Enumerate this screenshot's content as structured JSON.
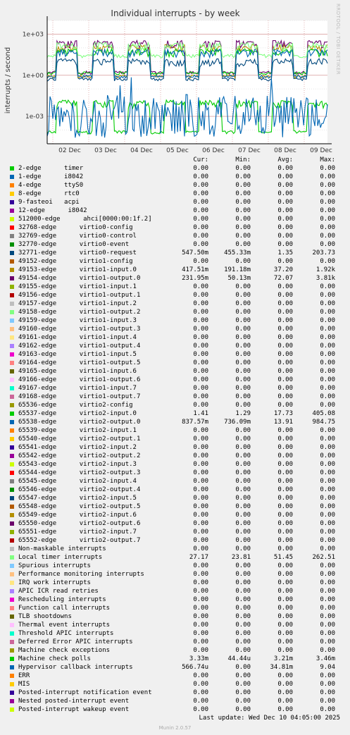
{
  "chart_data": {
    "type": "line",
    "title": "Individual interrupts - by week",
    "ylabel": "interrupts / second",
    "yscale": "log",
    "ylim": [
      1e-05,
      10000
    ],
    "yticks": [
      "1e+03",
      "1e+00",
      "1e-03"
    ],
    "xticks": [
      "02 Dec",
      "03 Dec",
      "04 Dec",
      "05 Dec",
      "06 Dec",
      "07 Dec",
      "08 Dec",
      "09 Dec"
    ],
    "grid": true,
    "columns": [
      "Cur:",
      "Min:",
      "Avg:",
      "Max:"
    ],
    "series": [
      {
        "name": "2-edge      timer",
        "color": "#00cc00",
        "cur": "0.00",
        "min": "0.00",
        "avg": "0.00",
        "max": "0.00"
      },
      {
        "name": "1-edge      i8042",
        "color": "#0066b3",
        "cur": "0.00",
        "min": "0.00",
        "avg": "0.00",
        "max": "0.00"
      },
      {
        "name": "4-edge      ttyS0",
        "color": "#ff8000",
        "cur": "0.00",
        "min": "0.00",
        "avg": "0.00",
        "max": "0.00"
      },
      {
        "name": "8-edge      rtc0",
        "color": "#ffcc00",
        "cur": "0.00",
        "min": "0.00",
        "avg": "0.00",
        "max": "0.00"
      },
      {
        "name": "9-fasteoi   acpi",
        "color": "#330099",
        "cur": "0.00",
        "min": "0.00",
        "avg": "0.00",
        "max": "0.00"
      },
      {
        "name": "12-edge      i8042",
        "color": "#990099",
        "cur": "0.00",
        "min": "0.00",
        "avg": "0.00",
        "max": "0.00"
      },
      {
        "name": "512000-edge      ahci[0000:00:1f.2]",
        "color": "#ccff00",
        "cur": "0.00",
        "min": "0.00",
        "avg": "0.00",
        "max": "0.00"
      },
      {
        "name": "32768-edge      virtio0-config",
        "color": "#ff0000",
        "cur": "0.00",
        "min": "0.00",
        "avg": "0.00",
        "max": "0.00"
      },
      {
        "name": "32769-edge      virtio0-control",
        "color": "#808080",
        "cur": "0.00",
        "min": "0.00",
        "avg": "0.00",
        "max": "0.00"
      },
      {
        "name": "32770-edge      virtio0-event",
        "color": "#008f00",
        "cur": "0.00",
        "min": "0.00",
        "avg": "0.00",
        "max": "0.00"
      },
      {
        "name": "32771-edge      virtio0-request",
        "color": "#00487d",
        "cur": "547.50m",
        "min": "455.33m",
        "avg": "1.35",
        "max": "203.73"
      },
      {
        "name": "49152-edge      virtio1-config",
        "color": "#b35a00",
        "cur": "0.00",
        "min": "0.00",
        "avg": "0.00",
        "max": "0.00"
      },
      {
        "name": "49153-edge      virtio1-input.0",
        "color": "#b38f00",
        "cur": "417.51m",
        "min": "191.18m",
        "avg": "37.20",
        "max": "1.92k"
      },
      {
        "name": "49154-edge      virtio1-output.0",
        "color": "#6b006b",
        "cur": "231.95m",
        "min": "50.13m",
        "avg": "72.07",
        "max": "3.81k"
      },
      {
        "name": "49155-edge      virtio1-input.1",
        "color": "#8fb300",
        "cur": "0.00",
        "min": "0.00",
        "avg": "0.00",
        "max": "0.00"
      },
      {
        "name": "49156-edge      virtio1-output.1",
        "color": "#b30000",
        "cur": "0.00",
        "min": "0.00",
        "avg": "0.00",
        "max": "0.00"
      },
      {
        "name": "49157-edge      virtio1-input.2",
        "color": "#bebebe",
        "cur": "0.00",
        "min": "0.00",
        "avg": "0.00",
        "max": "0.00"
      },
      {
        "name": "49158-edge      virtio1-output.2",
        "color": "#80ff80",
        "cur": "0.00",
        "min": "0.00",
        "avg": "0.00",
        "max": "0.00"
      },
      {
        "name": "49159-edge      virtio1-input.3",
        "color": "#80c9ff",
        "cur": "0.00",
        "min": "0.00",
        "avg": "0.00",
        "max": "0.00"
      },
      {
        "name": "49160-edge      virtio1-output.3",
        "color": "#ffc080",
        "cur": "0.00",
        "min": "0.00",
        "avg": "0.00",
        "max": "0.00"
      },
      {
        "name": "49161-edge      virtio1-input.4",
        "color": "#ffe680",
        "cur": "0.00",
        "min": "0.00",
        "avg": "0.00",
        "max": "0.00"
      },
      {
        "name": "49162-edge      virtio1-output.4",
        "color": "#aa80ff",
        "cur": "0.00",
        "min": "0.00",
        "avg": "0.00",
        "max": "0.00"
      },
      {
        "name": "49163-edge      virtio1-input.5",
        "color": "#ee00cc",
        "cur": "0.00",
        "min": "0.00",
        "avg": "0.00",
        "max": "0.00"
      },
      {
        "name": "49164-edge      virtio1-output.5",
        "color": "#ff8080",
        "cur": "0.00",
        "min": "0.00",
        "avg": "0.00",
        "max": "0.00"
      },
      {
        "name": "49165-edge      virtio1-input.6",
        "color": "#666600",
        "cur": "0.00",
        "min": "0.00",
        "avg": "0.00",
        "max": "0.00"
      },
      {
        "name": "49166-edge      virtio1-output.6",
        "color": "#ffbfff",
        "cur": "0.00",
        "min": "0.00",
        "avg": "0.00",
        "max": "0.00"
      },
      {
        "name": "49167-edge      virtio1-input.7",
        "color": "#00ffcc",
        "cur": "0.00",
        "min": "0.00",
        "avg": "0.00",
        "max": "0.00"
      },
      {
        "name": "49168-edge      virtio1-output.7",
        "color": "#cc6699",
        "cur": "0.00",
        "min": "0.00",
        "avg": "0.00",
        "max": "0.00"
      },
      {
        "name": "65536-edge      virtio2-config",
        "color": "#999900",
        "cur": "0.00",
        "min": "0.00",
        "avg": "0.00",
        "max": "0.00"
      },
      {
        "name": "65537-edge      virtio2-input.0",
        "color": "#00cc00",
        "cur": "1.41",
        "min": "1.29",
        "avg": "17.73",
        "max": "405.08"
      },
      {
        "name": "65538-edge      virtio2-output.0",
        "color": "#0066b3",
        "cur": "837.57m",
        "min": "736.09m",
        "avg": "13.91",
        "max": "984.75"
      },
      {
        "name": "65539-edge      virtio2-input.1",
        "color": "#ff8000",
        "cur": "0.00",
        "min": "0.00",
        "avg": "0.00",
        "max": "0.00"
      },
      {
        "name": "65540-edge      virtio2-output.1",
        "color": "#ffcc00",
        "cur": "0.00",
        "min": "0.00",
        "avg": "0.00",
        "max": "0.00"
      },
      {
        "name": "65541-edge      virtio2-input.2",
        "color": "#330099",
        "cur": "0.00",
        "min": "0.00",
        "avg": "0.00",
        "max": "0.00"
      },
      {
        "name": "65542-edge      virtio2-output.2",
        "color": "#990099",
        "cur": "0.00",
        "min": "0.00",
        "avg": "0.00",
        "max": "0.00"
      },
      {
        "name": "65543-edge      virtio2-input.3",
        "color": "#ccff00",
        "cur": "0.00",
        "min": "0.00",
        "avg": "0.00",
        "max": "0.00"
      },
      {
        "name": "65544-edge      virtio2-output.3",
        "color": "#ff0000",
        "cur": "0.00",
        "min": "0.00",
        "avg": "0.00",
        "max": "0.00"
      },
      {
        "name": "65545-edge      virtio2-input.4",
        "color": "#808080",
        "cur": "0.00",
        "min": "0.00",
        "avg": "0.00",
        "max": "0.00"
      },
      {
        "name": "65546-edge      virtio2-output.4",
        "color": "#008f00",
        "cur": "0.00",
        "min": "0.00",
        "avg": "0.00",
        "max": "0.00"
      },
      {
        "name": "65547-edge      virtio2-input.5",
        "color": "#00487d",
        "cur": "0.00",
        "min": "0.00",
        "avg": "0.00",
        "max": "0.00"
      },
      {
        "name": "65548-edge      virtio2-output.5",
        "color": "#b35a00",
        "cur": "0.00",
        "min": "0.00",
        "avg": "0.00",
        "max": "0.00"
      },
      {
        "name": "65549-edge      virtio2-input.6",
        "color": "#b38f00",
        "cur": "0.00",
        "min": "0.00",
        "avg": "0.00",
        "max": "0.00"
      },
      {
        "name": "65550-edge      virtio2-output.6",
        "color": "#6b006b",
        "cur": "0.00",
        "min": "0.00",
        "avg": "0.00",
        "max": "0.00"
      },
      {
        "name": "65551-edge      virtio2-input.7",
        "color": "#8fb300",
        "cur": "0.00",
        "min": "0.00",
        "avg": "0.00",
        "max": "0.00"
      },
      {
        "name": "65552-edge      virtio2-output.7",
        "color": "#b30000",
        "cur": "0.00",
        "min": "0.00",
        "avg": "0.00",
        "max": "0.00"
      },
      {
        "name": "Non-maskable interrupts",
        "color": "#bebebe",
        "cur": "0.00",
        "min": "0.00",
        "avg": "0.00",
        "max": "0.00"
      },
      {
        "name": "Local timer interrupts",
        "color": "#80ff80",
        "cur": "27.17",
        "min": "23.81",
        "avg": "51.45",
        "max": "262.51"
      },
      {
        "name": "Spurious interrupts",
        "color": "#80c9ff",
        "cur": "0.00",
        "min": "0.00",
        "avg": "0.00",
        "max": "0.00"
      },
      {
        "name": "Performance monitoring interrupts",
        "color": "#ffc080",
        "cur": "0.00",
        "min": "0.00",
        "avg": "0.00",
        "max": "0.00"
      },
      {
        "name": "IRQ work interrupts",
        "color": "#ffe680",
        "cur": "0.00",
        "min": "0.00",
        "avg": "0.00",
        "max": "0.00"
      },
      {
        "name": "APIC ICR read retries",
        "color": "#aa80ff",
        "cur": "0.00",
        "min": "0.00",
        "avg": "0.00",
        "max": "0.00"
      },
      {
        "name": "Rescheduling interrupts",
        "color": "#ee00cc",
        "cur": "0.00",
        "min": "0.00",
        "avg": "0.00",
        "max": "0.00"
      },
      {
        "name": "Function call interrupts",
        "color": "#ff8080",
        "cur": "0.00",
        "min": "0.00",
        "avg": "0.00",
        "max": "0.00"
      },
      {
        "name": "TLB shootdowns",
        "color": "#666600",
        "cur": "0.00",
        "min": "0.00",
        "avg": "0.00",
        "max": "0.00"
      },
      {
        "name": "Thermal event interrupts",
        "color": "#ffbfff",
        "cur": "0.00",
        "min": "0.00",
        "avg": "0.00",
        "max": "0.00"
      },
      {
        "name": "Threshold APIC interrupts",
        "color": "#00ffcc",
        "cur": "0.00",
        "min": "0.00",
        "avg": "0.00",
        "max": "0.00"
      },
      {
        "name": "Deferred Error APIC interrupts",
        "color": "#cc6699",
        "cur": "0.00",
        "min": "0.00",
        "avg": "0.00",
        "max": "0.00"
      },
      {
        "name": "Machine check exceptions",
        "color": "#999900",
        "cur": "0.00",
        "min": "0.00",
        "avg": "0.00",
        "max": "0.00"
      },
      {
        "name": "Machine check polls",
        "color": "#00cc00",
        "cur": "3.33m",
        "min": "44.44u",
        "avg": "3.21m",
        "max": "3.46m"
      },
      {
        "name": "Hypervisor callback interrupts",
        "color": "#0066b3",
        "cur": "566.74u",
        "min": "0.00",
        "avg": "34.81m",
        "max": "9.04"
      },
      {
        "name": "ERR",
        "color": "#ff8000",
        "cur": "0.00",
        "min": "0.00",
        "avg": "0.00",
        "max": "0.00"
      },
      {
        "name": "MIS",
        "color": "#ffcc00",
        "cur": "0.00",
        "min": "0.00",
        "avg": "0.00",
        "max": "0.00"
      },
      {
        "name": "Posted-interrupt notification event",
        "color": "#330099",
        "cur": "0.00",
        "min": "0.00",
        "avg": "0.00",
        "max": "0.00"
      },
      {
        "name": "Nested posted-interrupt event",
        "color": "#990099",
        "cur": "0.00",
        "min": "0.00",
        "avg": "0.00",
        "max": "0.00"
      },
      {
        "name": "Posted-interrupt wakeup event",
        "color": "#ccff00",
        "cur": "0.00",
        "min": "0.00",
        "avg": "0.00",
        "max": "0.00"
      }
    ]
  },
  "last_update": "Last update: Wed Dec 10 04:05:00 2025",
  "footer": "Munin 2.0.57",
  "side_label": "RRDTOOL / TOBI OETIKER"
}
